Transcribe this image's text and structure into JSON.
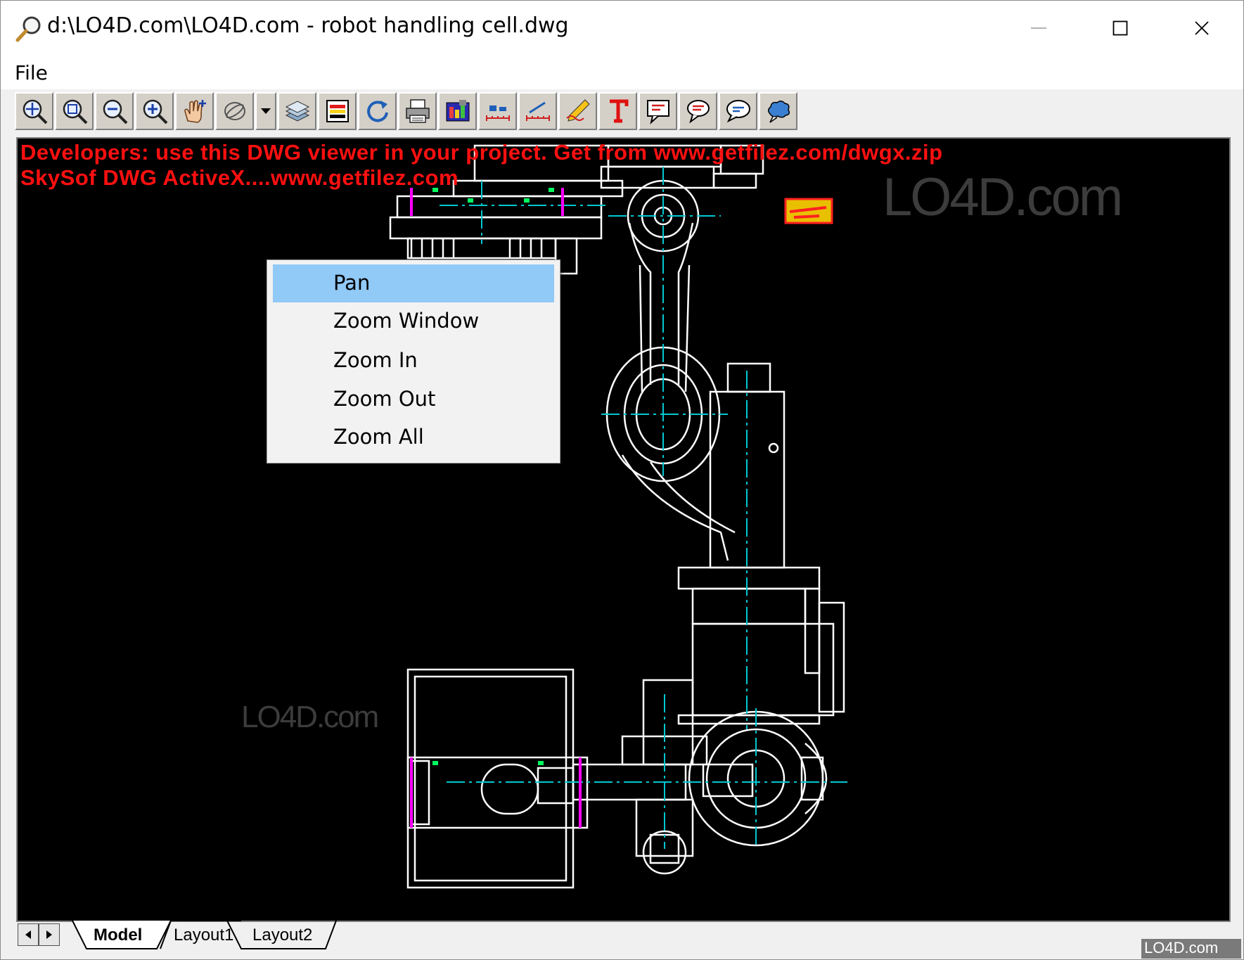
{
  "window": {
    "title": "d:\\LO4D.com\\LO4D.com - robot handling cell.dwg",
    "icon": "magnifier-icon"
  },
  "menubar": {
    "file": "File"
  },
  "toolbar": {
    "buttons": [
      "zoom-extents-icon",
      "zoom-window-icon",
      "zoom-out-icon",
      "zoom-in-icon",
      "pan-hand-icon",
      "orbit-icon",
      "dropdown-arrow-icon",
      "layers-icon",
      "layer-colors-icon",
      "regenerate-icon",
      "print-icon",
      "properties-icon",
      "measure-distance-icon",
      "measure-angle-icon",
      "markup-pencil-icon",
      "text-markup-icon",
      "comment-icon",
      "comment-cloud-icon",
      "comment-bubble-icon",
      "revision-cloud-icon"
    ]
  },
  "canvas": {
    "promo_line1": "Developers: use this DWG viewer in your project. Get from www.getfilez.com/dwgx.zip",
    "promo_line2": "SkySof DWG ActiveX....www.getfilez.com",
    "watermark": "LO4D.com",
    "background": "#000000",
    "line_color": "#ffffff",
    "centerline_color": "#00c8d2",
    "accent_color": "#ff00ff"
  },
  "context_menu": {
    "items": [
      {
        "label": "Pan",
        "highlighted": true
      },
      {
        "label": "Zoom Window",
        "highlighted": false
      },
      {
        "label": "Zoom In",
        "highlighted": false
      },
      {
        "label": "Zoom Out",
        "highlighted": false
      },
      {
        "label": "Zoom All",
        "highlighted": false
      }
    ],
    "highlight_color": "#91c9f7"
  },
  "tabs": {
    "items": [
      "Model",
      "Layout1",
      "Layout2"
    ],
    "active": "Model"
  },
  "corner_watermark": "LO4D.com"
}
